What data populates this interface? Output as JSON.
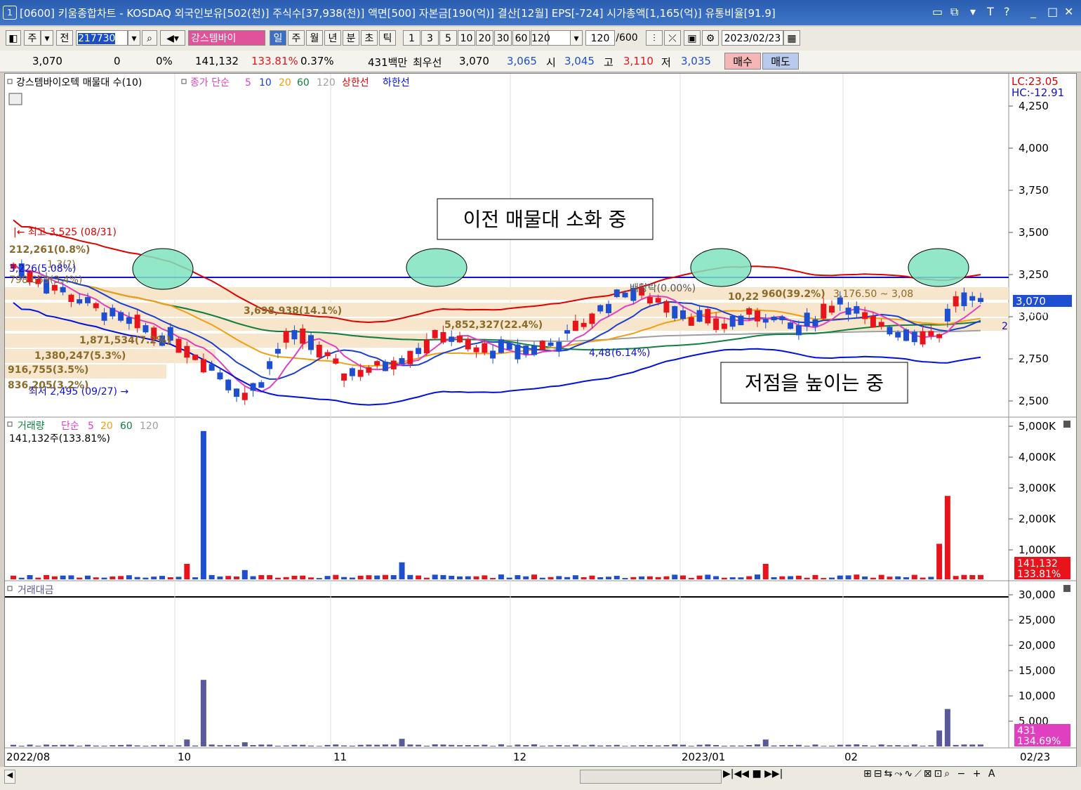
{
  "window": {
    "index": "1",
    "title": "[0600] 키움종합차트 - KOSDAQ 외국인보유[502(천)] 주식수[37,938(천)] 액면[500] 자본금[190(억)] 결산[12월] EPS[-724] 시가총액[1,165(억)] 유통비율[91.9]",
    "controls": [
      "□",
      "⧉",
      "▾",
      "T",
      "?",
      "_",
      "□",
      "✕"
    ]
  },
  "toolbar": {
    "type_label": "주",
    "prev_label": "전",
    "code_value": "217730",
    "stock_name": "강스템바이",
    "period_buttons": [
      "일",
      "주",
      "월",
      "년",
      "분",
      "초",
      "틱"
    ],
    "selected_period": "일",
    "interval_buttons": [
      "1",
      "3",
      "5",
      "10",
      "20",
      "30",
      "60",
      "120"
    ],
    "count_value": "120",
    "count_total": "/600",
    "date_value": "2023/02/23"
  },
  "quote": {
    "price": "3,070",
    "change": "0",
    "change_pct": "0%",
    "volume": "141,132",
    "volume_ratio": "133.81%",
    "turnover": "0.37%",
    "amount": "431백만",
    "best_label": "최우선",
    "best_price": "3,070",
    "bid_price": "3,065",
    "open_label": "시",
    "open": "3,045",
    "high_label": "고",
    "high": "3,110",
    "low_label": "저",
    "low": "3,035",
    "buy_label": "매수",
    "sell_label": "매도"
  },
  "price_panel": {
    "legend_name": "강스템바이오텍 매물대 수(10)",
    "ma_label": "종가 단순",
    "ma_periods": [
      "5",
      "10",
      "20",
      "60",
      "120"
    ],
    "upper_label": "상한선",
    "lower_label": "하한선",
    "lc": "LC:23.05",
    "hc": "HC:-12.91",
    "y_ticks": [
      "4,250",
      "4,000",
      "3,750",
      "3,500",
      "3,250",
      "3,000",
      "2,750",
      "2,500"
    ],
    "current_price": "3,070",
    "current_pct": "0.00%",
    "right_edge_marker": "2",
    "annotations": {
      "high": "최고 3,525 (08/31)",
      "low": "최저 2,495 (09/27)",
      "dividend": "배당락(0.00%)",
      "range": "3,176.50 ~ 3,08",
      "low2": "4,48"
    },
    "volume_profile": [
      "212,261(0.8%)",
      "1,3(?)",
      "3,226(5.08%)",
      "798,659(3.4%)",
      "3,698,938(14.1%)",
      "1,871,534(7.2%)",
      "1,380,247(5.3%)",
      "916,755(3.5%)",
      "836,205(3.2%)",
      "5,852,327(22.4%)",
      "10,22",
      "960(39.2%)",
      "(6.14%)"
    ],
    "callouts": [
      "이전 매물대 소화 중",
      "저점을 높이는 중"
    ]
  },
  "volume_panel": {
    "legend_name": "거래량",
    "ma_label": "단순",
    "ma_periods": [
      "5",
      "20",
      "60",
      "120"
    ],
    "current_text": "141,132주(133.81%)",
    "y_ticks": [
      "5,000K",
      "4,000K",
      "3,000K",
      "2,000K",
      "1,000K"
    ],
    "badge_value": "141,132",
    "badge_pct": "133.81%"
  },
  "amount_panel": {
    "legend_name": "거래대금",
    "y_ticks": [
      "30,000",
      "25,000",
      "20,000",
      "15,000",
      "10,000",
      "5,000"
    ],
    "badge_value": "431",
    "badge_pct": "134.69%"
  },
  "x_axis": {
    "labels": [
      "2022/08",
      "10",
      "11",
      "12",
      "2023/01",
      "02"
    ],
    "end_label": "02/23"
  },
  "colors": {
    "up": "#e8141c",
    "down": "#1e4fd0",
    "ma5": "#e040c0",
    "ma10": "#1a3fd0",
    "ma20": "#f0a010",
    "ma60": "#108040",
    "ma120": "#a0a0a0",
    "upper": "#e00000",
    "lower": "#0010e0",
    "profile": "#f7e6cc",
    "amount_bar": "#5a5a9a",
    "highlight": "#7fe3c0"
  },
  "chart_data": {
    "type": "candlestick",
    "period": "daily",
    "x_range": [
      "2022/08",
      "2023/02/23"
    ],
    "ylim": [
      2400,
      4400
    ],
    "last": {
      "date": "2023/02/23",
      "open": 3045,
      "high": 3110,
      "low": 3035,
      "close": 3070
    },
    "resistance_line": 3240,
    "volume_ylim": [
      0,
      5000000
    ],
    "amount_ylim": [
      0,
      30000
    ]
  }
}
